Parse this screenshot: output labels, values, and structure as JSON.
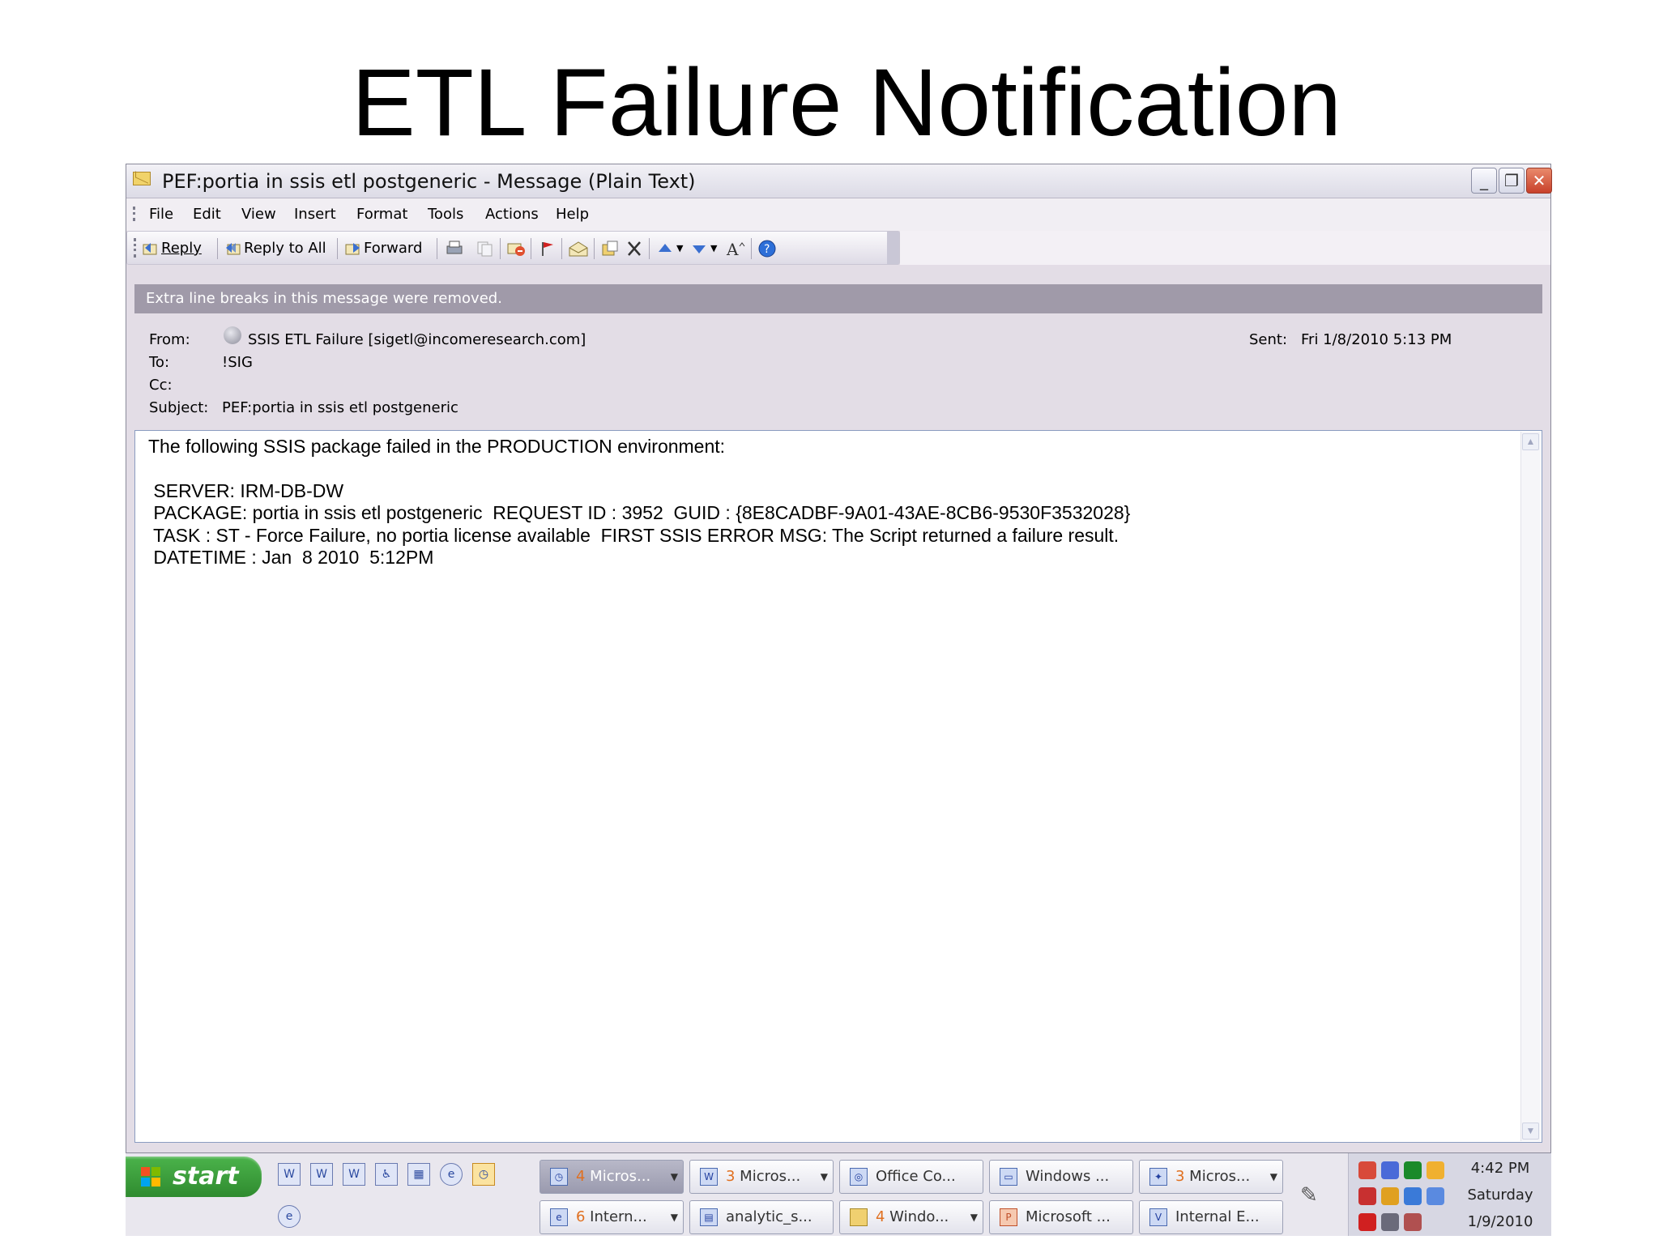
{
  "slide": {
    "title": "ETL Failure Notification"
  },
  "window": {
    "title": "PEF:portia in ssis etl postgeneric - Message (Plain Text)",
    "controls": {
      "minimize": "_",
      "restore": "❐",
      "close": "✕"
    }
  },
  "menu": [
    "File",
    "Edit",
    "View",
    "Insert",
    "Format",
    "Tools",
    "Actions",
    "Help"
  ],
  "toolbar": {
    "reply": "Reply",
    "reply_all": "Reply to All",
    "forward": "Forward"
  },
  "info_bar": "Extra line breaks in this message were removed.",
  "header": {
    "from_label": "From:",
    "from_value": "SSIS ETL Failure [sigetl@incomeresearch.com]",
    "to_label": "To:",
    "to_value": "!SIG",
    "cc_label": "Cc:",
    "cc_value": "",
    "subject_label": "Subject:",
    "subject_value": "PEF:portia in ssis etl postgeneric",
    "sent_label": "Sent:",
    "sent_value": "Fri 1/8/2010 5:13 PM"
  },
  "body": {
    "line1": "The following SSIS package failed in the PRODUCTION environment:",
    "line2": " SERVER: IRM-DB-DW",
    "line3": " PACKAGE: portia in ssis etl postgeneric  REQUEST ID : 3952  GUID : {8E8CADBF-9A01-43AE-8CB6-9530F3532028}",
    "line4": " TASK : ST - Force Failure, no portia license available  FIRST SSIS ERROR MSG: The Script returned a failure result.",
    "line5": " DATETIME : Jan  8 2010  5:12PM"
  },
  "taskbar": {
    "start_label": "start",
    "tasks_row1": [
      {
        "count": "4",
        "label": " Micros..."
      },
      {
        "count": "3",
        "label": " Micros..."
      },
      {
        "count": "",
        "label": "Office Co..."
      },
      {
        "count": "",
        "label": "Windows ..."
      },
      {
        "count": "3",
        "label": " Micros..."
      }
    ],
    "tasks_row2": [
      {
        "count": "6",
        "label": " Intern..."
      },
      {
        "count": "",
        "label": "analytic_s..."
      },
      {
        "count": "4",
        "label": " Windo..."
      },
      {
        "count": "",
        "label": "Microsoft ..."
      },
      {
        "count": "",
        "label": "Internal E..."
      }
    ],
    "clock": {
      "time": "4:42 PM",
      "day": "Saturday",
      "date": "1/9/2010"
    }
  }
}
